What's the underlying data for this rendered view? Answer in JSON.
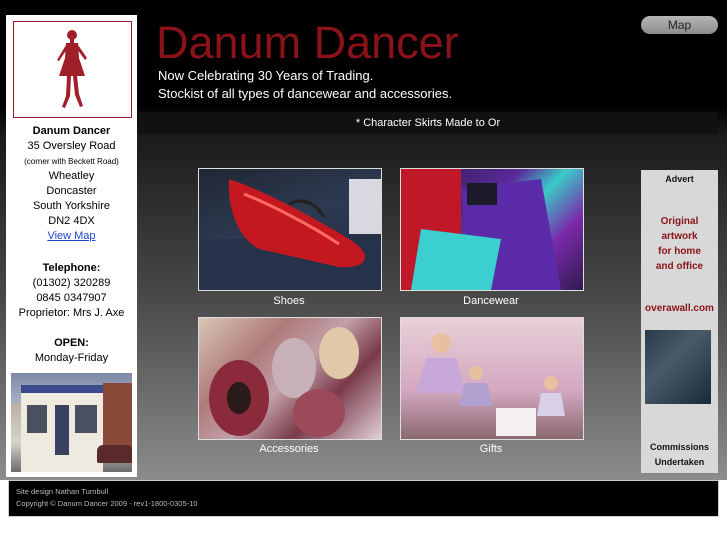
{
  "header": {
    "title": "Danum Dancer",
    "tagline_1": "Now Celebrating 30 Years of Trading.",
    "tagline_2": "Stockist of all types of dancewear and accessories.",
    "map_button": "Map",
    "ticker": "* Character Skirts Made to Or"
  },
  "sidebar": {
    "name": "Danum Dancer",
    "address": [
      "35 Oversley Road"
    ],
    "note": "(corner with Beckett Road)",
    "address_rest": [
      "Wheatley",
      "Doncaster",
      "South Yorkshire",
      "DN2 4DX"
    ],
    "view_map": "View Map",
    "telephone_label": "Telephone:",
    "phones": [
      "(01302) 320289",
      "0845 0347907"
    ],
    "proprietor": "Proprietor: Mrs J. Axe",
    "open_label": "OPEN:",
    "open_days": "Monday-Friday"
  },
  "products": [
    {
      "label": "Shoes"
    },
    {
      "label": "Dancewear"
    },
    {
      "label": "Accessories"
    },
    {
      "label": "Gifts"
    }
  ],
  "advert": {
    "heading": "Advert",
    "lines": [
      "Original",
      "artwork",
      "for home",
      "and office"
    ],
    "url": "overawall.com",
    "footer_lines": [
      "Commissions",
      "Undertaken"
    ]
  },
  "footer": {
    "design": "Site design Nathan Turnbull",
    "copyright": "Copyright © Danum Dancer 2009 - rev1-1800-0305-10"
  },
  "colors": {
    "brand_red": "#8b1219",
    "background": "#000000"
  }
}
